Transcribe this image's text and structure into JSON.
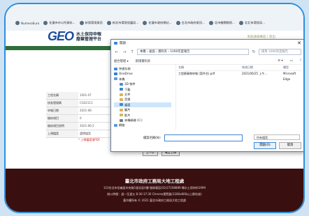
{
  "browser": {
    "bookmarks": [
      "NumeroEuro",
      "花蓮市市公所資料...",
      "新版環境資訊",
      "新北市環境保護局...",
      "花蓮市政府網站...",
      "台北市政府資訊...",
      "北市機關網頁...",
      "北北市環保局..."
    ]
  },
  "site": {
    "logo_mark": "GEO",
    "logo_line1": "水土保持申報",
    "logo_line2": "廢棄管理平台",
    "top_note": "系統通報專區 | 登出"
  },
  "form": {
    "rows": [
      {
        "k": "工程名稱",
        "v": "1001-07"
      },
      {
        "k": "核准證號碼",
        "v": "CGS2111"
      },
      {
        "k": "申報日期",
        "v": "2021-06-"
      },
      {
        "k": "檢核項目",
        "v": "0"
      },
      {
        "k": "檢核項目說明",
        "v": "2021-06-2"
      },
      {
        "k": "上傳檔案",
        "v": "選擇檔案"
      }
    ],
    "red_note": "* 上傳檔案限PDF"
  },
  "bottom_buttons": [
    "上一步",
    "確定上傳"
  ],
  "footer": {
    "title": "臺北市政府工務局大地工程處",
    "line1": "110台北市信義區市府路1號北區4樓   服務電話(02)27208889 轉水土保持科1999",
    "line2": "辦公時間：週一至週五 8:30-17:30   Chrome瀏覽器(1280x800以上解析度)",
    "line3": "著作權所有 © 2021 臺北市政府工務局大地工程處"
  },
  "dialog": {
    "title": "開啟",
    "path": "本機 › 桌面 › 資料夾 › 1090年度報告",
    "search_placeholder": "搜尋 1090年度報告",
    "toolbar_org": "組合管理 ▾",
    "toolbar_new": "新增資料夾",
    "tree": [
      {
        "label": "快速存取",
        "color": "#3c8be0"
      },
      {
        "label": "OneDrive",
        "color": "#2e7fd6"
      },
      {
        "label": "本機",
        "color": "#5a9bd8"
      },
      {
        "label": "3D 物件",
        "color": "#4a8fd0"
      },
      {
        "label": "下載",
        "color": "#3b85cc"
      },
      {
        "label": "文件",
        "color": "#d9b35a"
      },
      {
        "label": "音樂",
        "color": "#d9b35a"
      },
      {
        "label": "桌面",
        "color": "#3c87d6"
      },
      {
        "label": "圖片",
        "color": "#d9b35a"
      },
      {
        "label": "影片",
        "color": "#d9b35a"
      },
      {
        "label": "本機磁碟 (C:)",
        "color": "#6e7c8c"
      },
      {
        "label": "網路",
        "color": "#5a9bd8"
      }
    ],
    "headers": [
      "名稱",
      "修改日期",
      "類型"
    ],
    "files": [
      {
        "name": "工程廢棄物申報 (案件名).pdf",
        "date": "2021/06/25 上午...",
        "type": "Microsoft Edge"
      }
    ],
    "filename_label": "檔案名稱(N):",
    "filter": "所有檔案",
    "open": "開啟(O)",
    "cancel": "取消"
  }
}
